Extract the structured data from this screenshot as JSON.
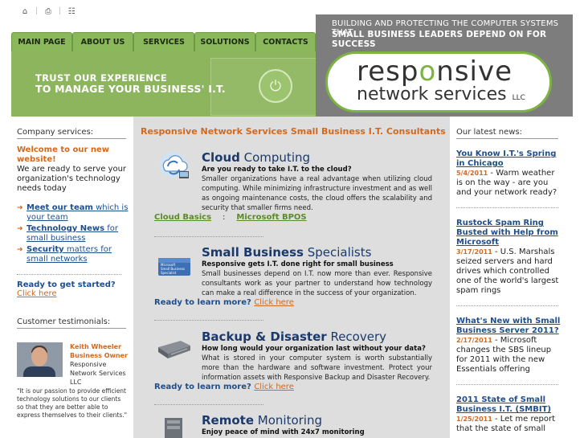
{
  "util": {
    "icons": [
      "home-icon",
      "print-icon",
      "sitemap-icon"
    ]
  },
  "header": {
    "tagline1": "BUILDING AND PROTECTING THE COMPUTER SYSTEMS THAT",
    "tagline2": "SMALL BUSINESS LEADERS DEPEND ON FOR SUCCESS",
    "logo_part1a": "resp",
    "logo_part1b": "o",
    "logo_part1c": "nsive",
    "logo_part2": "network services",
    "logo_llc": "LLC",
    "hero_line1": "TRUST OUR EXPERIENCE",
    "hero_line2": "TO MANAGE YOUR BUSINESS' I.T."
  },
  "nav": {
    "items": [
      "MAIN PAGE",
      "ABOUT US",
      "SERVICES",
      "SOLUTIONS",
      "CONTACTS"
    ]
  },
  "left": {
    "section_title": "Company services:",
    "welcome": "Welcome to our new website!",
    "intro": "We are ready to serve your organization's technology needs today",
    "links": [
      {
        "bold": "Meet our team",
        "rest": " which is your team"
      },
      {
        "bold": "Technology News",
        "rest": " for small business"
      },
      {
        "bold": "Security",
        "rest": " matters for small networks"
      }
    ],
    "ready": "Ready to get started?",
    "click_here": "Click here",
    "testimonials_title": "Customer testimonials:",
    "testimonial": {
      "name": "Keith Wheeler",
      "role": "Business Owner",
      "company": "Responsive Network Services LLC",
      "quote": "\"It is our passion to provide efficient technology solutions to our clients so that they are better able to express themselves to their clients.\""
    }
  },
  "center": {
    "title": "Responsive Network Services Small Business I.T. Consultants",
    "services": [
      {
        "heading_bold": "Cloud",
        "heading_rest": " Computing",
        "question": "Are you ready to take I.T. to the cloud?",
        "body": "Smaller organizations have a real advantage when utilizing cloud computing.  While minimizing infrastructure investment and as well as ongoing maintenance costs, the cloud offers the scalability and security that smaller firms need.",
        "link1": "Cloud Basics",
        "link2": "Microsoft BPOS"
      },
      {
        "heading_bold": "Small Business",
        "heading_rest": " Specialists",
        "question": "Responsive gets I.T. done right for small business",
        "body": "Small businesses depend on I.T. now more than ever. Responsive consultants work as your partner to understand how technology can make a real difference in the success of your organization.",
        "ready": "Ready to learn more?",
        "click_here": "Click here",
        "icon_text": "Microsoft Small Business Specialist"
      },
      {
        "heading_bold": "Backup & Disaster",
        "heading_rest": " Recovery",
        "question": "How long would your organization last without your data?",
        "body": "What is stored in your computer system is worth substantially more than the hardware and software investment. Protect your information assets with Responsive Backup and Disaster Recovery.",
        "ready": "Ready to learn more?",
        "click_here": "Click here"
      },
      {
        "heading_bold": "Remote",
        "heading_rest": " Monitoring",
        "question": "Enjoy peace of mind with 24x7 monitoring"
      }
    ]
  },
  "right": {
    "title": "Our latest news:",
    "news": [
      {
        "title": "You Know I.T.'s Spring in Chicago",
        "date": "5/4/2011",
        "text": "Warm weather is on the way - are you and your network ready?"
      },
      {
        "title": "Rustock Spam Ring Busted with Help from Microsoft",
        "date": "3/17/2011",
        "text": "U.S. Marshals seized servers and hard drives which controlled one of the world's largest spam rings"
      },
      {
        "title": "What's New with Small Business Server 2011?",
        "date": "2/17/2011",
        "text": "Microsoft changes the SBS lineup for 2011 with the new Essentials offering"
      },
      {
        "title": "2011 State of Small Business I.T. (SMBIT)",
        "date": "1/25/2011",
        "text": "Let me report that the state of small"
      }
    ]
  }
}
